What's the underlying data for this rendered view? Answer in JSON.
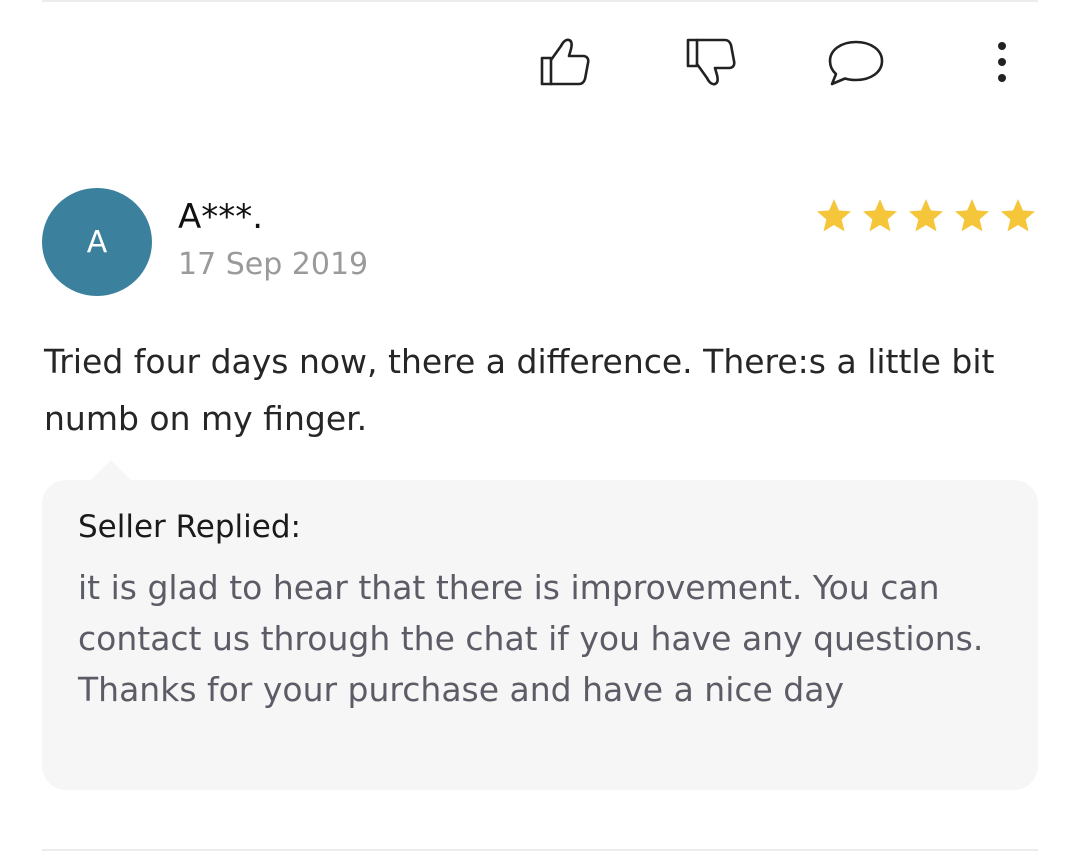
{
  "actions": {
    "like_icon": "thumbs-up-icon",
    "dislike_icon": "thumbs-down-icon",
    "comment_icon": "chat-bubble-icon",
    "more_icon": "more-vertical-icon"
  },
  "review": {
    "avatar_letter": "A",
    "avatar_color": "#3b819d",
    "reviewer_name": "A***.",
    "date": "17 Sep 2019",
    "rating": 5,
    "rating_max": 5,
    "star_color": "#f5c53a",
    "text": "Tried four days now, there a difference. There:s a little bit numb on my finger."
  },
  "seller_reply": {
    "label": "Seller Replied:",
    "text": "it is glad to hear that there is improvement. You can contact us through the chat if you have any questions. Thanks for your purchase and have a nice day"
  }
}
